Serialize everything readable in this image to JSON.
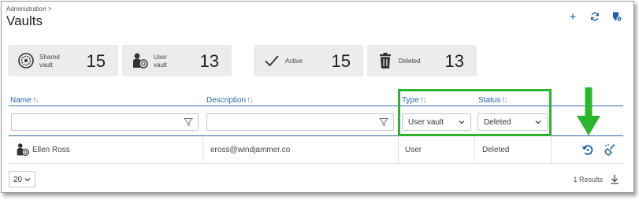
{
  "breadcrumb": "Administration",
  "breadcrumb_sep": ">",
  "page_title": "Vaults",
  "header_actions": [
    {
      "name": "add",
      "icon": "plus-icon",
      "glyph": "+"
    },
    {
      "name": "refresh",
      "icon": "refresh-icon"
    },
    {
      "name": "vault-settings",
      "icon": "shield-vault-icon"
    }
  ],
  "summary_cards": [
    {
      "icon": "shared-vault-icon",
      "label_line1": "Shared",
      "label_line2": "vault",
      "value": "15"
    },
    {
      "icon": "user-vault-icon",
      "label_line1": "User",
      "label_line2": "vault",
      "value": "13"
    },
    {
      "icon": "checkmark-icon",
      "label_line1": "Active",
      "label_line2": "",
      "value": "15"
    },
    {
      "icon": "trash-icon",
      "label_line1": "Deleted",
      "label_line2": "",
      "value": "13"
    }
  ],
  "columns": {
    "name": "Name",
    "description": "Description",
    "type": "Type",
    "status": "Status"
  },
  "filters": {
    "name_value": "",
    "description_value": "",
    "type_selected": "User vault",
    "status_selected": "Deleted"
  },
  "rows": [
    {
      "name": "Ellen Ross",
      "description": "eross@windjammer.co",
      "type": "User",
      "status": "Deleted"
    }
  ],
  "pagination": {
    "page_size": "20",
    "results": "1 Results"
  },
  "colors": {
    "accent_blue": "#1f5ea8",
    "highlight_green": "#2db52d",
    "card_bg": "#ececec"
  }
}
